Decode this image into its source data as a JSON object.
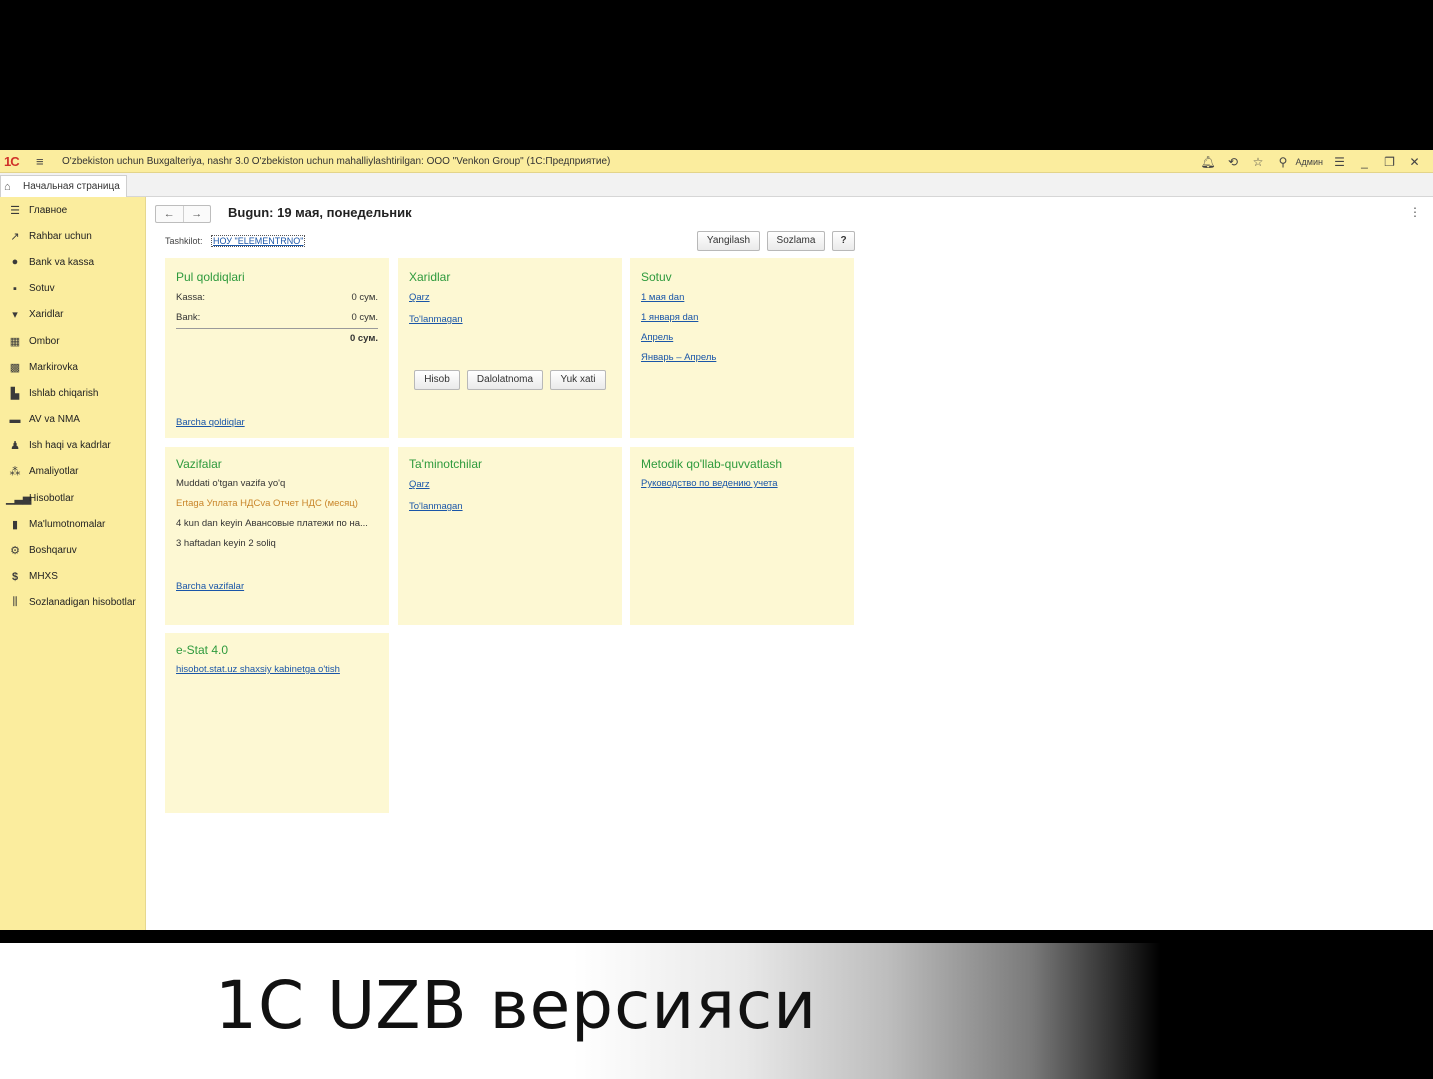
{
  "titlebar": {
    "logo": "1С",
    "window_title": "O'zbekiston uchun Buxgalteriya, nashr 3.0 O'zbekiston uchun mahalliylashtirilgan: OOO \"Venkon Group\"  (1С:Предприятие)",
    "user": "Админ"
  },
  "tabs": {
    "home": "Начальная страница"
  },
  "sidebar": {
    "items": [
      {
        "label": "Главное",
        "icon": "menu-lines-icon"
      },
      {
        "label": "Rahbar uchun",
        "icon": "trend-icon"
      },
      {
        "label": "Bank va kassa",
        "icon": "coin-icon"
      },
      {
        "label": "Sotuv",
        "icon": "bag-icon"
      },
      {
        "label": "Xaridlar",
        "icon": "cart-icon"
      },
      {
        "label": "Ombor",
        "icon": "grid-icon"
      },
      {
        "label": "Markirovka",
        "icon": "qr-icon"
      },
      {
        "label": "Ishlab chiqarish",
        "icon": "factory-icon"
      },
      {
        "label": "AV va NMA",
        "icon": "truck-icon"
      },
      {
        "label": "Ish haqi va kadrlar",
        "icon": "person-icon"
      },
      {
        "label": "Amaliyotlar",
        "icon": "operations-icon"
      },
      {
        "label": "Hisobotlar",
        "icon": "bar-chart-icon"
      },
      {
        "label": "Ma'lumotnomalar",
        "icon": "books-icon"
      },
      {
        "label": "Boshqaruv",
        "icon": "gear-icon"
      },
      {
        "label": "MHXS",
        "icon": "dollar-icon"
      },
      {
        "label": "Sozlanadigan hisobotlar",
        "icon": "report-config-icon"
      }
    ]
  },
  "header": {
    "title": "Bugun: 19 мая, понедельник",
    "org_label": "Tashkilot:",
    "org_value": "НОУ \"ELEMENTRNO\"",
    "refresh": "Yangilash",
    "settings": "Sozlama",
    "help": "?"
  },
  "panels": {
    "cash": {
      "title": "Pul qoldiqlari",
      "kassa_label": "Kassa:",
      "kassa_value": "0 сум.",
      "bank_label": "Bank:",
      "bank_value": "0 сум.",
      "total": "0 сум.",
      "link": "Barcha qoldiqlar"
    },
    "purchases": {
      "title": "Xaridlar",
      "debt": "Qarz",
      "unpaid": "To'lanmagan",
      "btn_invoice": "Hisob",
      "btn_act": "Dalolatnoma",
      "btn_waybill": "Yuk xati"
    },
    "sales": {
      "title": "Sotuv",
      "links": [
        "1 мая dan",
        "1 января dan",
        "Апрель",
        "Январь – Апрель"
      ]
    },
    "tasks": {
      "title": "Vazifalar",
      "overdue": "Muddati o'tgan vazifa yo'q",
      "tomorrow": "Ertaga Уплата НДСva Отчет НДС (месяц)",
      "in4days": "4 kun dan keyin Авансовые платежи по на...",
      "in3weeks": "3 haftadan keyin 2 soliq",
      "link": "Barcha vazifalar"
    },
    "suppliers": {
      "title": "Ta'minotchilar",
      "debt": "Qarz",
      "unpaid": "To'lanmagan"
    },
    "support": {
      "title": "Metodik qo'llab-quvvatlash",
      "link": "Руководство по ведению учета"
    },
    "estat": {
      "title": "e-Stat 4.0",
      "link": "hisobot.stat.uz shaxsiy kabinetga o'tish"
    }
  },
  "banner": {
    "text": "1С UZB версияси"
  }
}
